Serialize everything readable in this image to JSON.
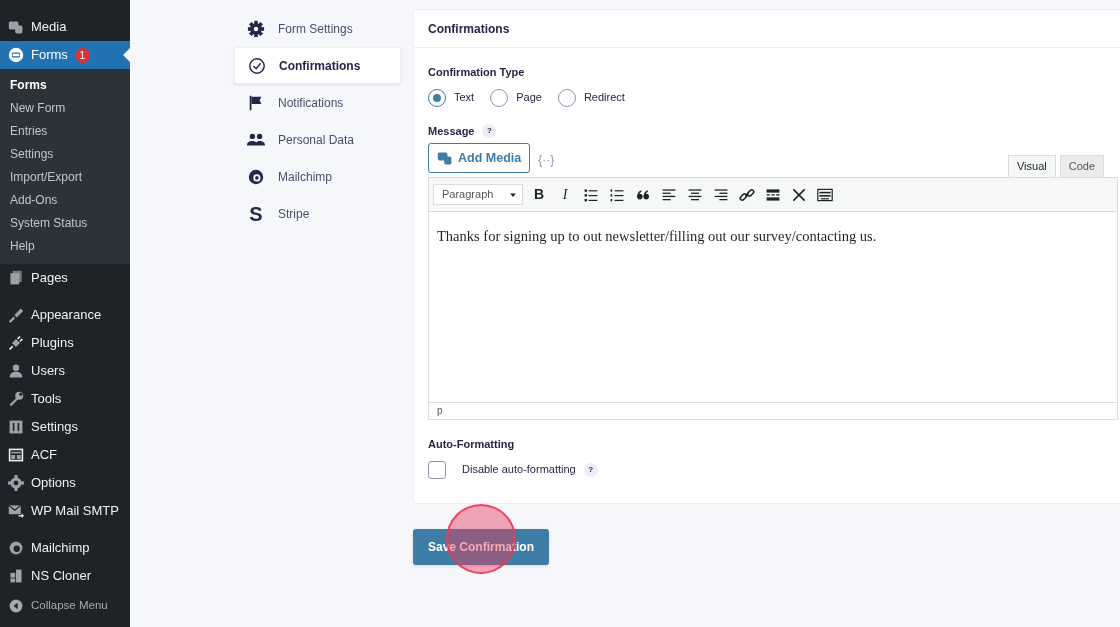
{
  "admin_menu": [
    {
      "label": "Media",
      "selected": false
    },
    {
      "label": "Forms",
      "selected": true,
      "badge": "1",
      "children": [
        {
          "label": "Forms",
          "selected": true
        },
        {
          "label": "New Form",
          "selected": false
        },
        {
          "label": "Entries",
          "selected": false
        },
        {
          "label": "Settings",
          "selected": false
        },
        {
          "label": "Import/Export",
          "selected": false
        },
        {
          "label": "Add-Ons",
          "selected": false
        },
        {
          "label": "System Status",
          "selected": false
        },
        {
          "label": "Help",
          "selected": false
        }
      ]
    },
    {
      "label": "Pages",
      "selected": false
    },
    {
      "label": "Appearance",
      "selected": false
    },
    {
      "label": "Plugins",
      "selected": false
    },
    {
      "label": "Users",
      "selected": false
    },
    {
      "label": "Tools",
      "selected": false
    },
    {
      "label": "Settings",
      "selected": false
    },
    {
      "label": "ACF",
      "selected": false
    },
    {
      "label": "Options",
      "selected": false
    },
    {
      "label": "WP Mail SMTP",
      "selected": false
    },
    {
      "label": "Mailchimp",
      "selected": false
    },
    {
      "label": "NS Cloner",
      "selected": false
    },
    {
      "label": "Collapse Menu",
      "selected": false
    }
  ],
  "settings_nav": [
    {
      "label": "Form Settings",
      "selected": false
    },
    {
      "label": "Confirmations",
      "selected": true
    },
    {
      "label": "Notifications",
      "selected": false
    },
    {
      "label": "Personal Data",
      "selected": false
    },
    {
      "label": "Mailchimp",
      "selected": false
    },
    {
      "label": "Stripe",
      "selected": false,
      "logo": "S"
    }
  ],
  "panel": {
    "title": "Confirmations",
    "confirmation_type": {
      "label": "Confirmation Type",
      "options": [
        {
          "label": "Text",
          "selected": true
        },
        {
          "label": "Page",
          "selected": false
        },
        {
          "label": "Redirect",
          "selected": false
        }
      ]
    },
    "message": {
      "label": "Message",
      "help": "?",
      "add_media": "Add Media",
      "merge_tags": "{··}",
      "tabs": [
        {
          "label": "Visual",
          "selected": true
        },
        {
          "label": "Code",
          "selected": false
        }
      ],
      "format": "Paragraph",
      "bold": "B",
      "italic": "I",
      "content": "Thanks for signing up to out newsletter/filling out our survey/contacting us.",
      "path": "p"
    },
    "auto_formatting": {
      "label": "Auto-Formatting",
      "checkbox": {
        "label": "Disable auto-formatting",
        "checked": false,
        "help": "?"
      }
    }
  },
  "save_button": "Save Confirmation"
}
